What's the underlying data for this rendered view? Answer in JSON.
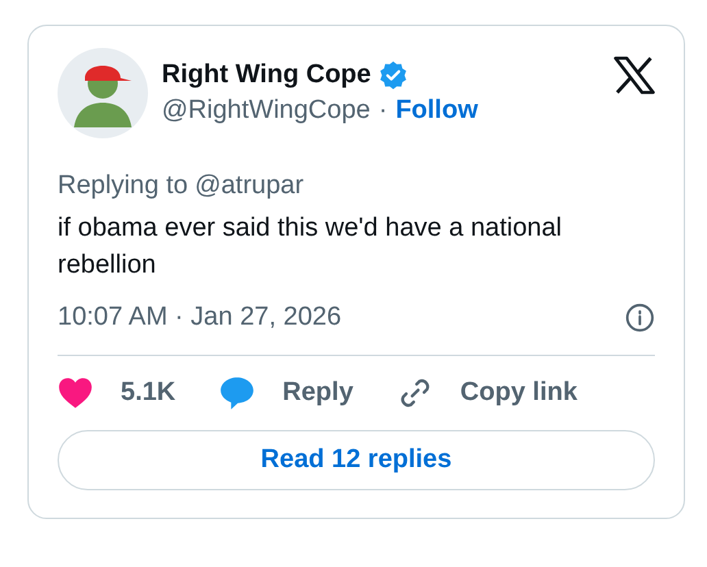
{
  "author": {
    "name": "Right Wing Cope",
    "verified": true,
    "handle": "@RightWingCope",
    "separator": "·",
    "follow": "Follow"
  },
  "replying_to": {
    "label": "Replying to",
    "mention": "@atrupar"
  },
  "text": "if obama ever said this we'd have a national rebellion",
  "timestamp": "10:07 AM · Jan 27, 2026",
  "actions": [
    {
      "kind": "like",
      "label": "5.1K"
    },
    {
      "kind": "reply",
      "label": "Reply"
    },
    {
      "kind": "copy",
      "label": "Copy link"
    }
  ],
  "read_replies": "Read 12 replies"
}
